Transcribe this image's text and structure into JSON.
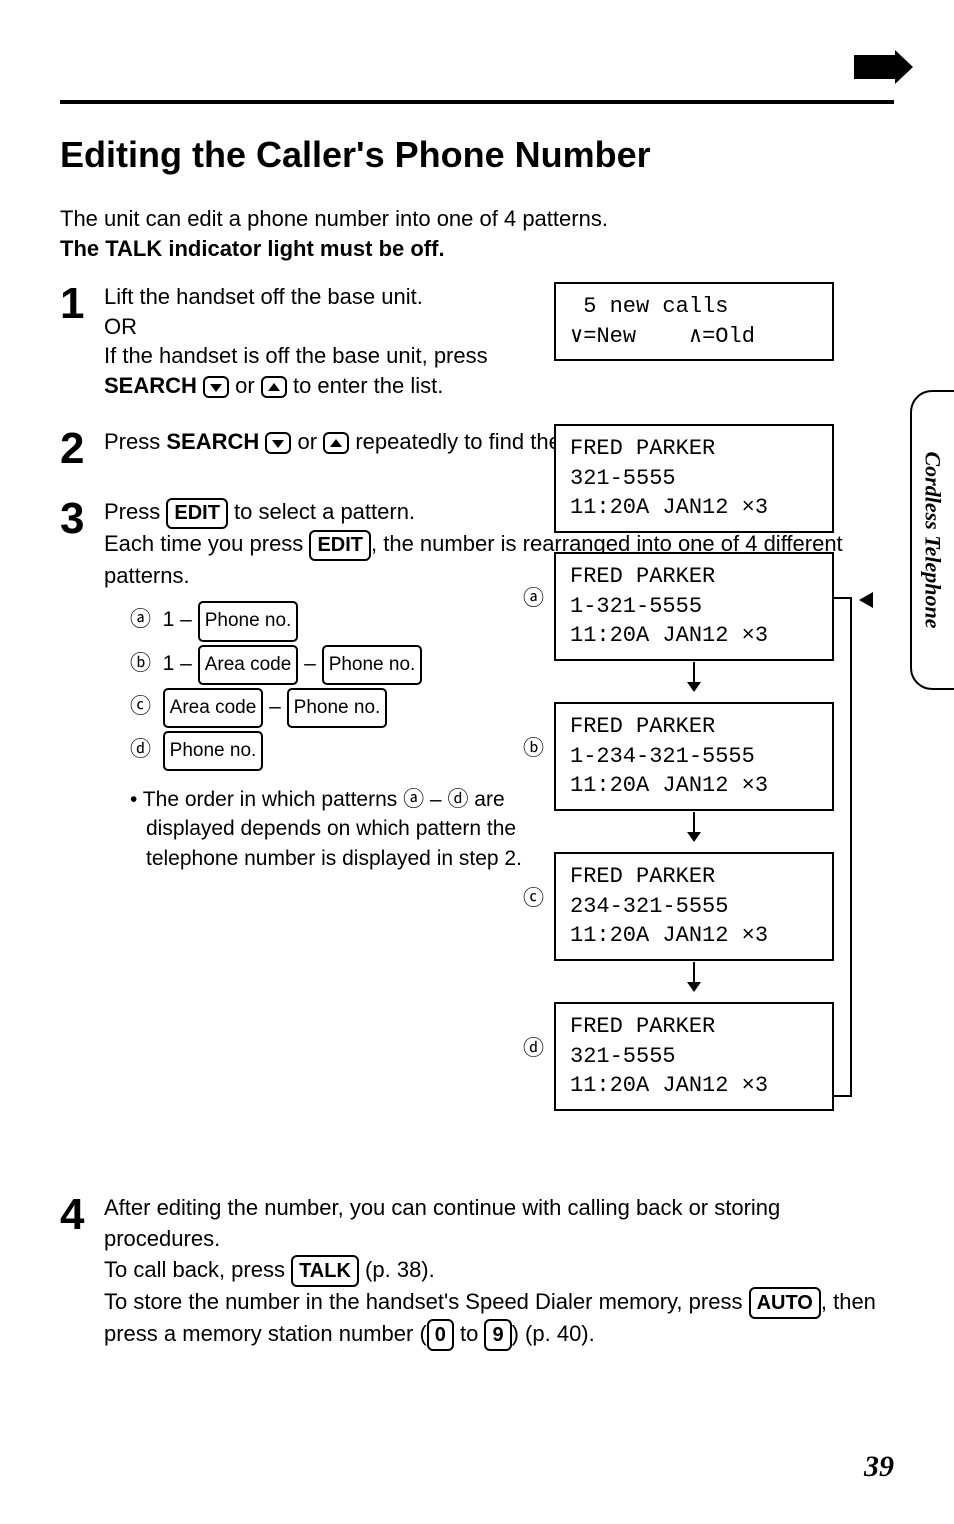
{
  "section_title": "Editing the Caller's Phone Number",
  "intro_line1": "The unit can edit a phone number into one of 4 patterns.",
  "intro_line2": "The TALK indicator light must be off.",
  "side_tab": "Cordless Telephone",
  "page_number": "39",
  "steps": {
    "s1": {
      "num": "1",
      "l1": "Lift the handset off the base unit.",
      "l2": "OR",
      "l3a": "If the handset is off the base unit, press",
      "l3b": "SEARCH",
      "l3c": " or ",
      "l3d": " to enter the list."
    },
    "s2": {
      "num": "2",
      "l1a": "Press ",
      "l1b": "SEARCH",
      "l1c": " or ",
      "l1d": " repeatedly to find the desired caller."
    },
    "s3": {
      "num": "3",
      "l1a": "Press ",
      "l1b": "EDIT",
      "l1c": " to select a pattern.",
      "l2a": "Each time you press ",
      "l2b": "EDIT",
      "l2c": ", the number is rearranged into one of 4 different patterns."
    },
    "s4": {
      "num": "4",
      "l1": "After editing the number, you can continue with calling back or storing procedures.",
      "l2a": "To call back, press ",
      "l2b": "TALK",
      "l2c": " (p. 38).",
      "l3a": "To store the number in the handset's Speed Dialer memory, press ",
      "l3b": "AUTO",
      "l3c": ", then press a memory station number (",
      "l3d": "0",
      "l3e": " to ",
      "l3f": "9",
      "l3g": ") (p. 40)."
    }
  },
  "patterns": {
    "a": {
      "lbl": "ⓐ",
      "t1": "1 – ",
      "box1": "Phone no."
    },
    "b": {
      "lbl": "ⓑ",
      "t1": "1 – ",
      "box1": "Area code",
      "t2": " – ",
      "box2": "Phone no."
    },
    "c": {
      "lbl": "ⓒ",
      "box1": "Area code",
      "t1": " – ",
      "box2": "Phone no."
    },
    "d": {
      "lbl": "ⓓ",
      "box1": "Phone no."
    }
  },
  "bullet": "• The order in which patterns ⓐ – ⓓ are displayed depends on which pattern the telephone number is displayed in step 2.",
  "lcds": {
    "l1": " 5 new calls\n∨=New    ∧=Old",
    "l2": "FRED PARKER\n321-5555\n11:20A JAN12 ×3",
    "la": "FRED PARKER\n1-321-5555\n11:20A JAN12 ×3",
    "lb": "FRED PARKER\n1-234-321-5555\n11:20A JAN12 ×3",
    "lc": "FRED PARKER\n234-321-5555\n11:20A JAN12 ×3",
    "ld": "FRED PARKER\n321-5555\n11:20A JAN12 ×3"
  },
  "circ": {
    "a": "ⓐ",
    "b": "ⓑ",
    "c": "ⓒ",
    "d": "ⓓ"
  }
}
